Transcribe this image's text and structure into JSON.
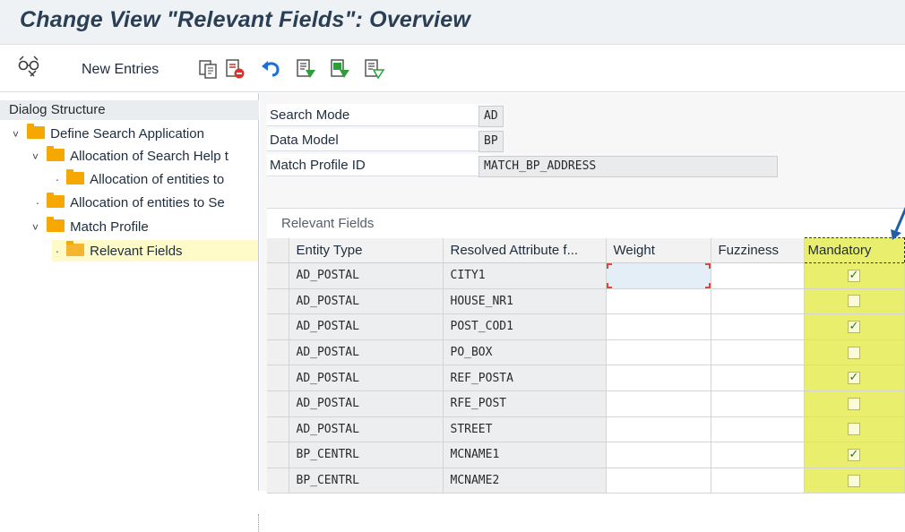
{
  "header": {
    "title": "Change View \"Relevant Fields\": Overview"
  },
  "toolbar": {
    "new_entries_label": "New Entries",
    "icons": [
      "display-change-icon",
      "copy-icon",
      "delete-icon",
      "undo-icon",
      "select-all-icon",
      "select-block-icon",
      "deselect-all-icon"
    ]
  },
  "dialog_structure": {
    "header": "Dialog Structure",
    "items": [
      {
        "label": "Define Search Application",
        "level": 0,
        "expanded": true
      },
      {
        "label": "Allocation of Search Help t",
        "level": 1,
        "expanded": true
      },
      {
        "label": "Allocation of entities to",
        "level": 2,
        "expanded": false
      },
      {
        "label": "Allocation of entities to Se",
        "level": 1,
        "expanded": false
      },
      {
        "label": "Match Profile",
        "level": 1,
        "expanded": true
      },
      {
        "label": "Relevant Fields",
        "level": 2,
        "selected": true
      }
    ]
  },
  "form": {
    "fields": [
      {
        "label": "Search Mode",
        "value": "AD"
      },
      {
        "label": "Data Model",
        "value": "BP"
      },
      {
        "label": "Match Profile ID",
        "value": "MATCH_BP_ADDRESS"
      }
    ]
  },
  "grid": {
    "title": "Relevant Fields",
    "columns": [
      "Entity Type",
      "Resolved Attribute f...",
      "Weight",
      "Fuzziness",
      "Mandatory"
    ],
    "rows": [
      {
        "entity": "AD_POSTAL",
        "attribute": "CITY1",
        "weight": "",
        "fuzziness": "",
        "mandatory": true
      },
      {
        "entity": "AD_POSTAL",
        "attribute": "HOUSE_NR1",
        "weight": "",
        "fuzziness": "",
        "mandatory": false
      },
      {
        "entity": "AD_POSTAL",
        "attribute": "POST_COD1",
        "weight": "",
        "fuzziness": "",
        "mandatory": true
      },
      {
        "entity": "AD_POSTAL",
        "attribute": "PO_BOX",
        "weight": "",
        "fuzziness": "",
        "mandatory": false
      },
      {
        "entity": "AD_POSTAL",
        "attribute": "REF_POSTA",
        "weight": "",
        "fuzziness": "",
        "mandatory": true
      },
      {
        "entity": "AD_POSTAL",
        "attribute": "RFE_POST",
        "weight": "",
        "fuzziness": "",
        "mandatory": false
      },
      {
        "entity": "AD_POSTAL",
        "attribute": "STREET",
        "weight": "",
        "fuzziness": "",
        "mandatory": false
      },
      {
        "entity": "BP_CENTRL",
        "attribute": "MCNAME1",
        "weight": "",
        "fuzziness": "",
        "mandatory": true
      },
      {
        "entity": "BP_CENTRL",
        "attribute": "MCNAME2",
        "weight": "",
        "fuzziness": "",
        "mandatory": false
      }
    ]
  },
  "colors": {
    "highlight": "#e9ef6c",
    "folder": "#f6a800",
    "check": "#2b7a1f",
    "arrow": "#1f5ea8"
  }
}
